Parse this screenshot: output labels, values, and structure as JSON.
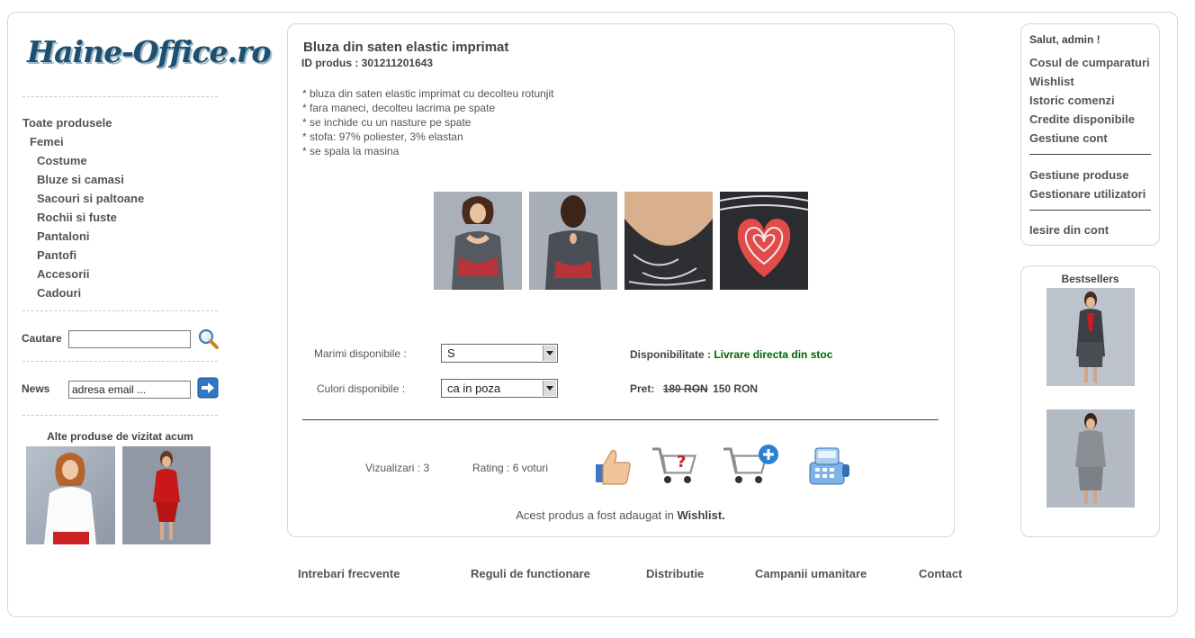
{
  "logo": {
    "text": "Haine-Office.ro"
  },
  "categories": {
    "all": "Toate produsele",
    "women": "Femei",
    "items": [
      "Costume",
      "Bluze si camasi",
      "Sacouri si paltoane",
      "Rochii si fuste",
      "Pantaloni",
      "Pantofi",
      "Accesorii",
      "Cadouri"
    ]
  },
  "search": {
    "label": "Cautare",
    "value": "",
    "icon": "magnifier-icon"
  },
  "news": {
    "label": "News",
    "value": "adresa email ...",
    "icon": "arrow-right-icon"
  },
  "recent": {
    "title": "Alte produse de vizitat acum"
  },
  "product": {
    "title": "Bluza din saten elastic imprimat",
    "id_label": "ID produs :",
    "id_value": "301211201643",
    "description": [
      "* bluza din saten elastic imprimat cu decolteu rotunjit",
      "* fara maneci, decolteu lacrima pe spate",
      "* se inchide cu un nasture pe spate",
      "* stofa: 97% poliester, 3% elastan",
      "* se spala la masina"
    ],
    "sizes_label": "Marimi disponibile :",
    "sizes_value": "S",
    "colors_label": "Culori disponibile :",
    "colors_value": "ca in poza",
    "availability_label": "Disponibilitate :",
    "availability_value": "Livrare directa din stoc",
    "price_label": "Pret:",
    "old_price": "180 RON",
    "new_price": "150 RON",
    "views_label": "Vizualizari : 3",
    "rating_label": "Rating : 6 voturi",
    "wishlist_msg": "Acest produs a fost adaugat in",
    "wishlist_word": "Wishlist."
  },
  "account": {
    "greeting": "Salut, admin !",
    "links1": [
      "Cosul de cumparaturi",
      "Wishlist",
      "Istoric comenzi",
      "Credite disponibile",
      "Gestiune cont"
    ],
    "links2": [
      "Gestiune produse",
      "Gestionare utilizatori"
    ],
    "logout": "Iesire din cont"
  },
  "bestsellers": {
    "title": "Bestsellers"
  },
  "footer": [
    "Intrebari frecvente",
    "Reguli de functionare",
    "Distributie",
    "Campanii umanitare",
    "Contact"
  ],
  "colors": {
    "availability": "#006600",
    "logo": "#1d4f6e",
    "border": "#d6d6d6"
  }
}
